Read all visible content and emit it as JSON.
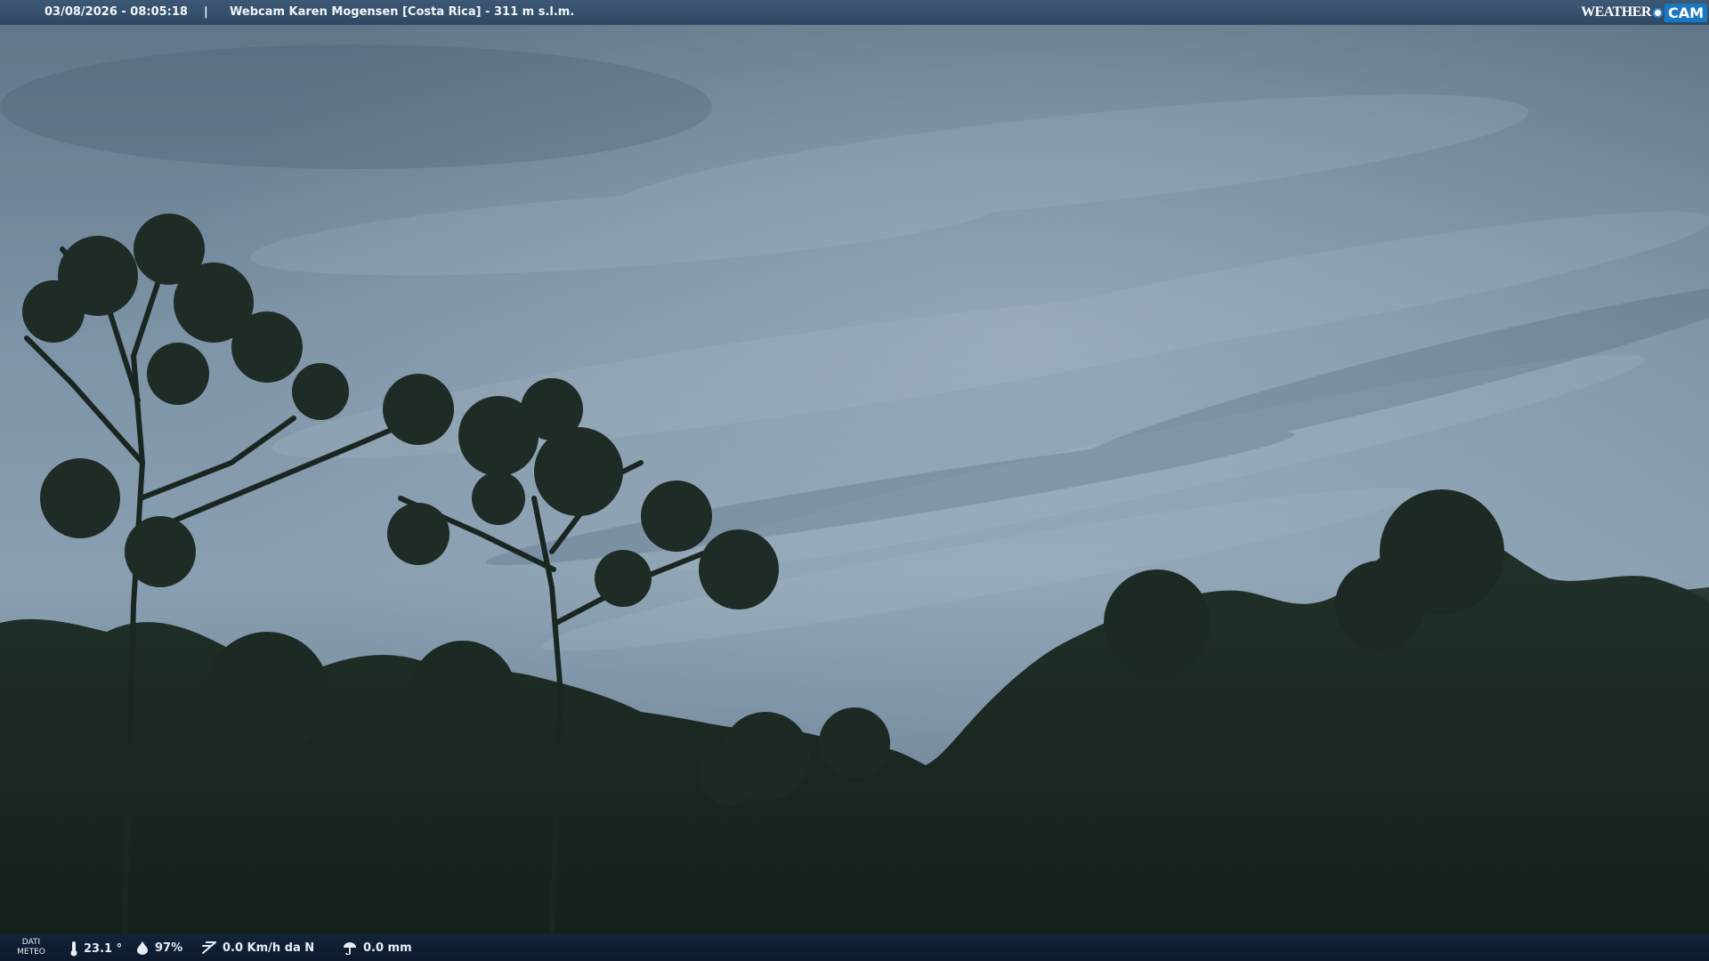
{
  "overlay": {
    "datetime": "03/08/2026 - 08:05:18",
    "separator": "|",
    "title": "Webcam Karen Mogensen [Costa Rica]  - 311 m s.l.m.",
    "logo": {
      "weather": "WEATHER",
      "cam": "CAM"
    }
  },
  "weather_data": {
    "label_line1": "DATI",
    "label_line2": "METEO",
    "temperature": "23.1 °",
    "humidity": "97%",
    "wind": "0.0 Km/h da N",
    "rain": "0.0 mm"
  },
  "icons": [
    "thermometer-icon",
    "humidity-icon",
    "wind-icon",
    "rain-icon"
  ],
  "colors": {
    "top_bar": "#3d5874",
    "bottom_bar": "#12243a",
    "sky": "#7f96aa",
    "foliage": "#1a2a22",
    "logo_accent": "#1a78c2"
  }
}
